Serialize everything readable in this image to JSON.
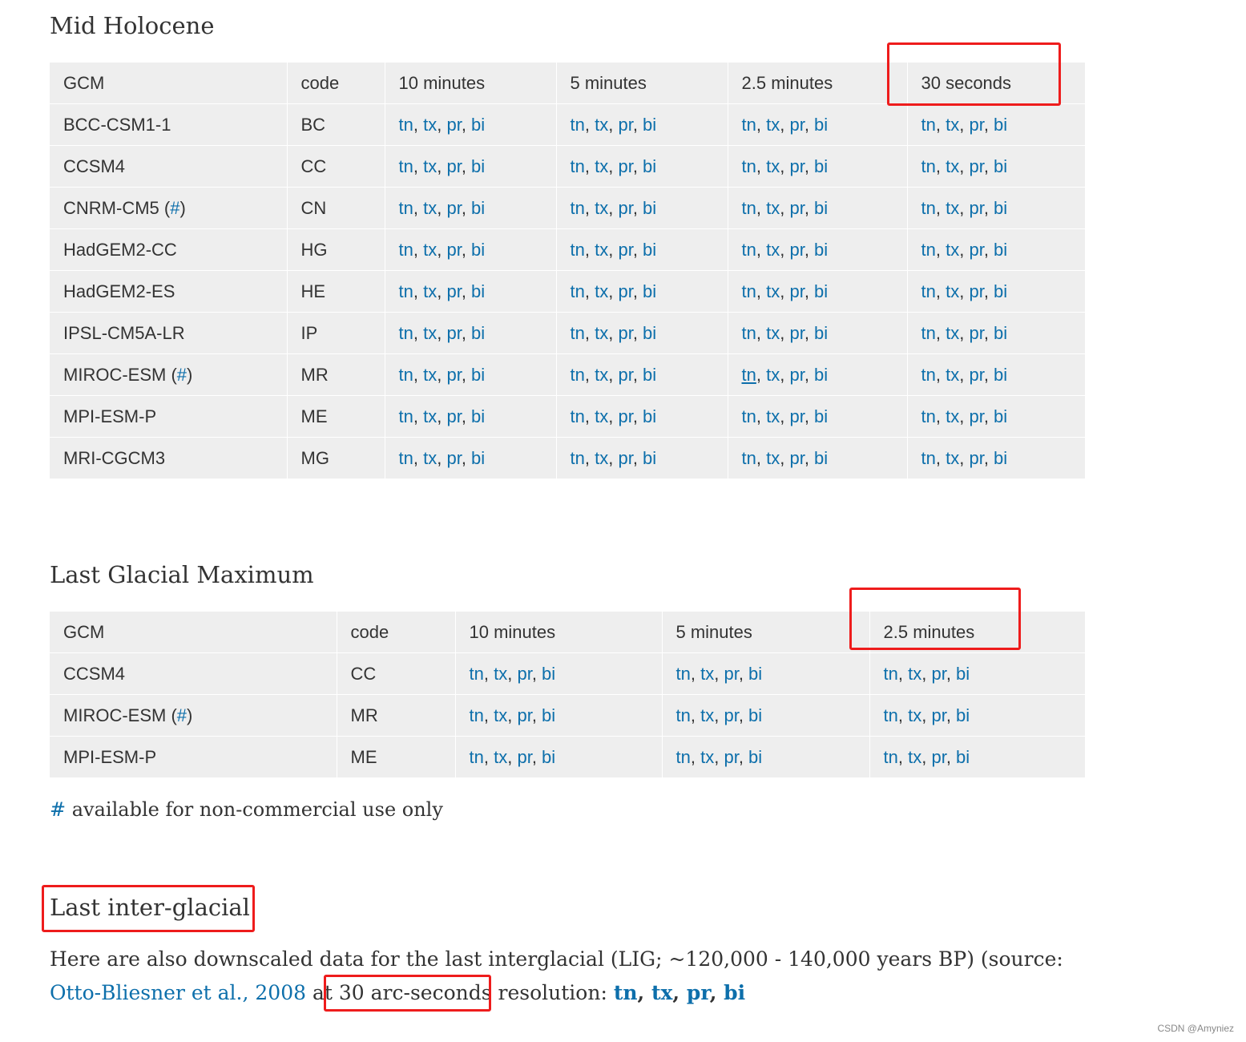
{
  "sections": {
    "mid": {
      "title": "Mid Holocene"
    },
    "lgm": {
      "title": "Last Glacial Maximum"
    },
    "lig": {
      "title": "Last inter-glacial",
      "text_before": "Here are also downscaled data for the last interglacial (LIG; ~120,000 - 140,000 years BP) (source: ",
      "source_link": "Otto-Bliesner et al., 2008",
      "text_at": " at ",
      "resolution": "30 arc-seconds",
      "text_after": " resolution: ",
      "vars": [
        "tn",
        "tx",
        "pr",
        "bi"
      ]
    }
  },
  "mid_table": {
    "headers": [
      "GCM",
      "code",
      "10 minutes",
      "5 minutes",
      "2.5 minutes",
      "30 seconds"
    ],
    "rows": [
      {
        "gcm": "BCC-CSM1-1",
        "code": "BC"
      },
      {
        "gcm": "CCSM4",
        "code": "CC"
      },
      {
        "gcm": "CNRM-CM5",
        "hash": "#",
        "code": "CN"
      },
      {
        "gcm": "HadGEM2-CC",
        "code": "HG"
      },
      {
        "gcm": "HadGEM2-ES",
        "code": "HE"
      },
      {
        "gcm": "IPSL-CM5A-LR",
        "code": "IP"
      },
      {
        "gcm": "MIROC-ESM",
        "hash": "#",
        "code": "MR"
      },
      {
        "gcm": "MPI-ESM-P",
        "code": "ME"
      },
      {
        "gcm": "MRI-CGCM3",
        "code": "MG"
      }
    ]
  },
  "lgm_table": {
    "headers": [
      "GCM",
      "code",
      "10 minutes",
      "5 minutes",
      "2.5 minutes"
    ],
    "rows": [
      {
        "gcm": "CCSM4",
        "code": "CC"
      },
      {
        "gcm": "MIROC-ESM",
        "hash": "#",
        "code": "MR"
      },
      {
        "gcm": "MPI-ESM-P",
        "code": "ME"
      }
    ]
  },
  "vars": [
    "tn",
    "tx",
    "pr",
    "bi"
  ],
  "note": {
    "hash": "#",
    "text": " available for non-commercial use only"
  },
  "watermark": "CSDN @Amyniez",
  "colors": {
    "link": "#0d6fab",
    "table_bg": "#eeeeee",
    "highlight_box": "#ee1c1c"
  }
}
